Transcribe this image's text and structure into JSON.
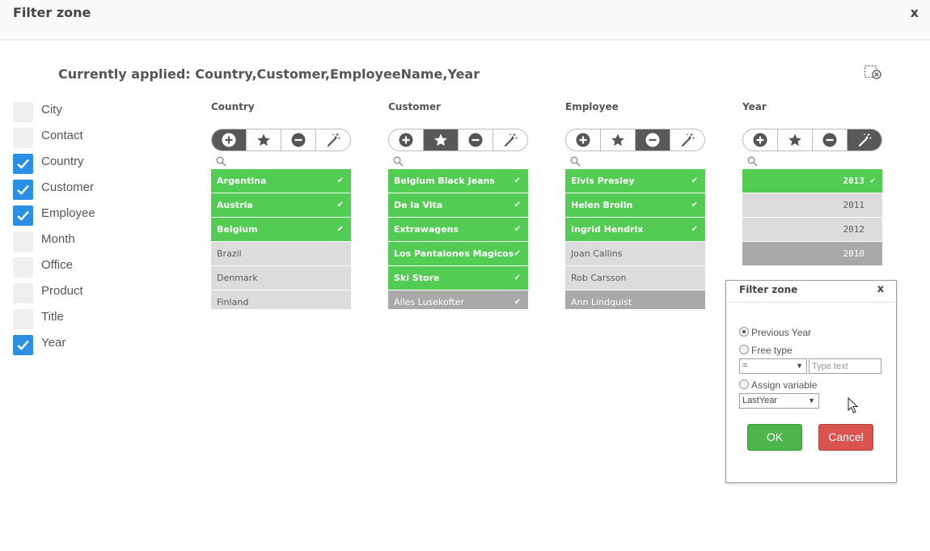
{
  "header": {
    "title": "Filter zone",
    "close": "x"
  },
  "applied": "Currently applied: Country,Customer,EmployeeName,Year",
  "fields": [
    {
      "label": "City",
      "checked": false
    },
    {
      "label": "Contact",
      "checked": false
    },
    {
      "label": "Country",
      "checked": true
    },
    {
      "label": "Customer",
      "checked": true
    },
    {
      "label": "Employee",
      "checked": true
    },
    {
      "label": "Month",
      "checked": false
    },
    {
      "label": "Office",
      "checked": false
    },
    {
      "label": "Product",
      "checked": false
    },
    {
      "label": "Title",
      "checked": false
    },
    {
      "label": "Year",
      "checked": true
    }
  ],
  "columns": [
    {
      "title": "Country",
      "active_tool": "include",
      "items": [
        {
          "label": "Argentina",
          "state": "selected"
        },
        {
          "label": "Austria",
          "state": "selected"
        },
        {
          "label": "Belgium",
          "state": "selected"
        },
        {
          "label": "Brazil",
          "state": "possible"
        },
        {
          "label": "Denmark",
          "state": "possible"
        },
        {
          "label": "Finland",
          "state": "possible"
        }
      ]
    },
    {
      "title": "Customer",
      "active_tool": "star",
      "items": [
        {
          "label": "Belgium Black Jeans",
          "state": "selected"
        },
        {
          "label": "De la Vita",
          "state": "selected"
        },
        {
          "label": "Extrawagens",
          "state": "selected"
        },
        {
          "label": "Los Pantalones Magicos",
          "state": "selected"
        },
        {
          "label": "Ski Store",
          "state": "selected"
        },
        {
          "label": "Alles Lusekofter",
          "state": "alternative"
        }
      ]
    },
    {
      "title": "Employee",
      "active_tool": "exclude",
      "items": [
        {
          "label": "Elvis Presley",
          "state": "selected"
        },
        {
          "label": "Helen Brolin",
          "state": "selected"
        },
        {
          "label": "Ingrid Hendrix",
          "state": "selected"
        },
        {
          "label": "Joan Callins",
          "state": "possible"
        },
        {
          "label": "Rob Carsson",
          "state": "possible"
        },
        {
          "label": "Ann Lindquist",
          "state": "alternative"
        }
      ]
    },
    {
      "title": "Year",
      "active_tool": "wand",
      "items": [
        {
          "label": "2013",
          "state": "selected"
        },
        {
          "label": "2011",
          "state": "possible"
        },
        {
          "label": "2012",
          "state": "possible"
        },
        {
          "label": "2010",
          "state": "alternative"
        }
      ]
    }
  ],
  "popup": {
    "title": "Filter zone",
    "close": "x",
    "option_previous_year": "Previous Year",
    "option_free_type": "Free type",
    "operator_value": "=",
    "text_placeholder": "Type text",
    "option_assign_variable": "Assign variable",
    "variable_value": "LastYear",
    "ok_label": "OK",
    "cancel_label": "Cancel"
  },
  "colors": {
    "selected": "#52cc52",
    "possible": "#dcdcdc",
    "alternative": "#a9a9a9",
    "checkbox": "#2c8fe6",
    "ok": "#4cb54c",
    "cancel": "#d9534f"
  },
  "icons": {
    "include": "plus-circle-icon",
    "star": "star-icon",
    "exclude": "minus-circle-icon",
    "wand": "magic-wand-icon",
    "search": "search-icon",
    "clear": "clear-selection-icon",
    "check": "check-icon"
  }
}
